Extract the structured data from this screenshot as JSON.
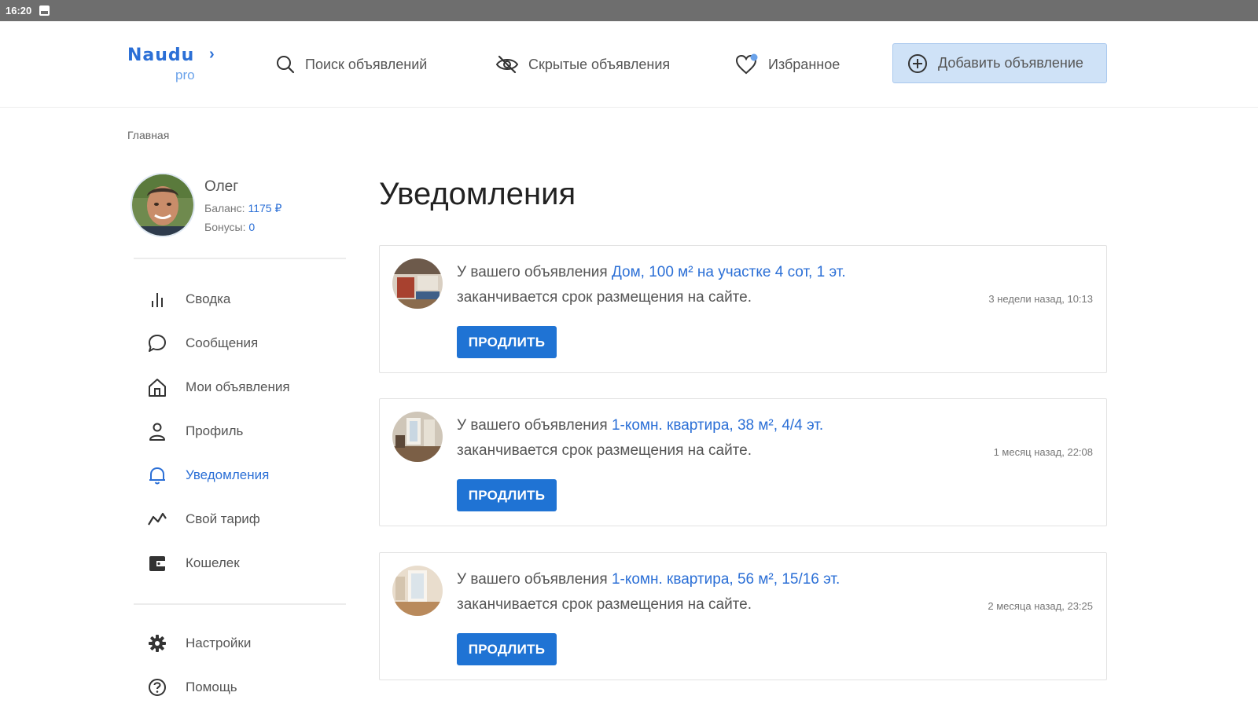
{
  "status_bar": {
    "time": "16:20"
  },
  "logo": {
    "word": "Naudu",
    "sub": "pro"
  },
  "nav": {
    "search": "Поиск объявлений",
    "hidden": "Скрытые объявления",
    "favorites": "Избранное",
    "add": "Добавить объявление"
  },
  "breadcrumb": "Главная",
  "user": {
    "name": "Олег",
    "balance_label": "Баланс:",
    "balance_value": "1175 ₽",
    "bonus_label": "Бонусы:",
    "bonus_value": "0"
  },
  "sidebar": {
    "items": [
      {
        "label": "Сводка",
        "icon": "bar-chart-icon"
      },
      {
        "label": "Сообщения",
        "icon": "chat-icon"
      },
      {
        "label": "Мои объявления",
        "icon": "home-icon"
      },
      {
        "label": "Профиль",
        "icon": "user-icon"
      },
      {
        "label": "Уведомления",
        "icon": "bell-icon",
        "active": true
      },
      {
        "label": "Свой тариф",
        "icon": "trend-icon"
      },
      {
        "label": "Кошелек",
        "icon": "wallet-icon"
      }
    ],
    "bottom_items": [
      {
        "label": "Настройки",
        "icon": "gear-icon"
      },
      {
        "label": "Помощь",
        "icon": "help-icon"
      }
    ]
  },
  "page_title": "Уведомления",
  "notifications": [
    {
      "prefix": "У вашего объявления ",
      "link": "Дом, 100 м² на участке 4 сот, 1 эт.",
      "suffix": "заканчивается срок размещения на сайте.",
      "time": "3 недели назад, 10:13",
      "button": "ПРОДЛИТЬ"
    },
    {
      "prefix": "У вашего объявления ",
      "link": "1-комн. квартира, 38 м², 4/4 эт.",
      "suffix": "заканчивается срок размещения на сайте.",
      "time": "1 месяц назад, 22:08",
      "button": "ПРОДЛИТЬ"
    },
    {
      "prefix": "У вашего объявления ",
      "link": "1-комн. квартира, 56 м², 15/16 эт.",
      "suffix": "заканчивается срок размещения на сайте.",
      "time": "2 месяца назад, 23:25",
      "button": "ПРОДЛИТЬ"
    }
  ],
  "colors": {
    "accent": "#2b6fd6",
    "button": "#1f73d4",
    "add_button_bg": "#cfe2f7",
    "status_bar": "#6e6e6e"
  }
}
